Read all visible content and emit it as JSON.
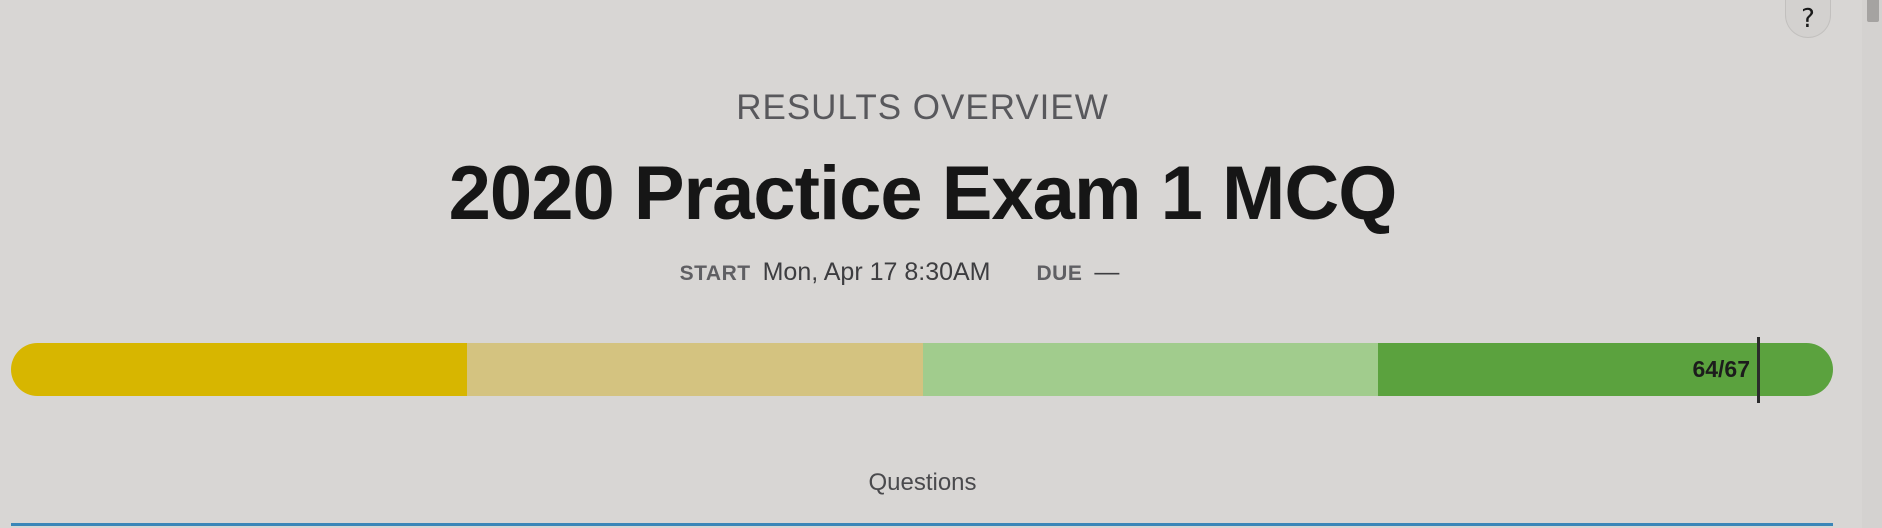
{
  "help": {
    "label": "?",
    "icon": "help-icon"
  },
  "header": {
    "overline": "RESULTS OVERVIEW",
    "title": "2020 Practice Exam 1 MCQ"
  },
  "dates": {
    "start_label": "START",
    "start_value": "Mon, Apr 17 8:30AM",
    "due_label": "DUE",
    "due_value": "—"
  },
  "progress": {
    "score_text": "64/67",
    "score": 64,
    "total": 67,
    "segment_colors": [
      "#d7b600",
      "#d4c380",
      "#a1cc8d",
      "#5ba23e"
    ],
    "marker_color": "#2b2b2b"
  },
  "tabs": {
    "active_label": "Questions",
    "underline_color": "#3a86b8"
  }
}
